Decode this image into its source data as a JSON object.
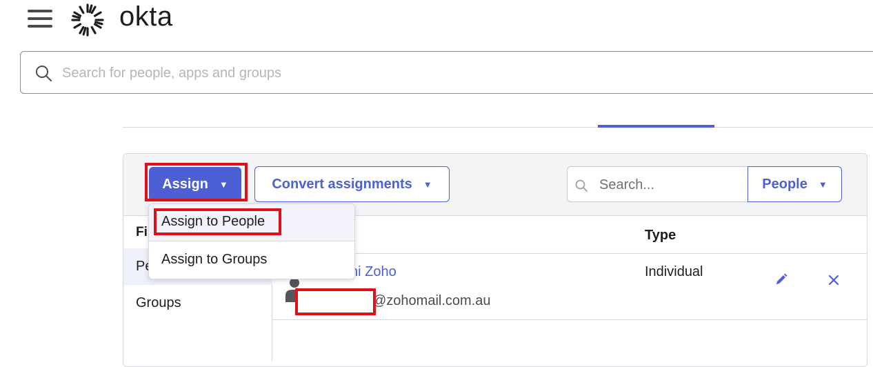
{
  "header": {
    "logo_text": "okta",
    "menu_icon": "hamburger-menu-icon",
    "logo_icon": "okta-sunburst-logo-icon"
  },
  "global_search": {
    "placeholder": "Search for people, apps and groups",
    "value": "",
    "icon": "search-icon"
  },
  "toolbar": {
    "assign_label": "Assign",
    "convert_label": "Convert assignments",
    "search_placeholder": "Search...",
    "people_select_value": "People",
    "caret_glyph": "▼"
  },
  "assign_menu": {
    "items": [
      {
        "label": "Assign to People"
      },
      {
        "label": "Assign to Groups"
      }
    ]
  },
  "filters": {
    "heading": "Fil",
    "items": [
      {
        "label": "Pe"
      },
      {
        "label": "Groups"
      }
    ]
  },
  "table": {
    "columns": {
      "type": "Type"
    },
    "rows": [
      {
        "name": "ni Zoho",
        "email": "@zohomail.com.au",
        "type": "Individual"
      }
    ]
  },
  "colors": {
    "accent": "#4c5fd5",
    "highlight": "#e0101a",
    "text": "#1d1d21"
  }
}
